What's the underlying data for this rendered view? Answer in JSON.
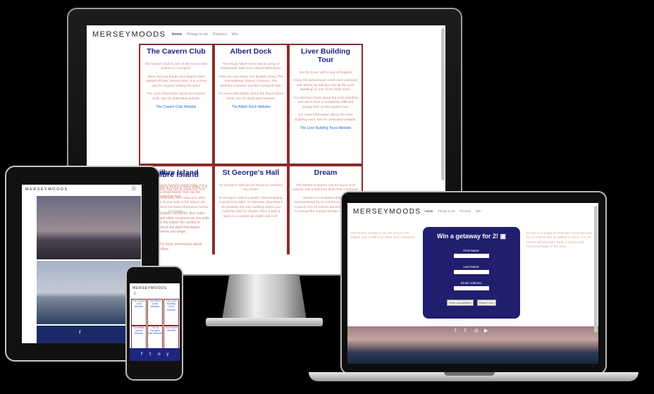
{
  "site": {
    "brand": "MERSEYMOODS",
    "nav": [
      "Home",
      "Things to do",
      "Pictures",
      "Win"
    ]
  },
  "cards": [
    {
      "title": "The Cavern Club",
      "paragraphs": [
        "The Cavern Club is one of the most iconic scenes in Liverpool.",
        "Many famous bands and singers have started off their careers here. It is a must see for anyone visiting the area!",
        "For more information about the Cavern Club, see it's dedicated website."
      ],
      "link": "The Cavern Club Website"
    },
    {
      "title": "Albert Dock",
      "paragraphs": [
        "The Royal Albert Dock has an array of restaurants, bars and cultural attractions.",
        "Here you can enjoy The Beatles Story, The International Slavery museum, The Maritime museum and the Liverpool Tate.",
        "For more information about the Royal Albert Dock, see it's dedicated website."
      ],
      "link": "The Albert Dock Website"
    },
    {
      "title": "Liver Building Tour",
      "paragraphs": [
        "Not for those with a fear of heights!",
        "Enjoy the picturesque views over Liverpool and Wirral, by taking a trip up the Liver Building on one of the daily tours.",
        "You will learn facts about the Liver Building and see it from a completely different perspective on this guided tour.",
        "For more information about the Liver Building tours, see it's dedicated website."
      ],
      "link": "The Liver Building Tours Website"
    },
    {
      "title": "Hilbre Island",
      "paragraphs": [
        "Hilbre Island is found in West Kirby, it is a small island, that can be visited by foot.",
        "Explore rockpools, find crabs and other creatures as you walk to the island. Be careful to check the tidal information before you begin."
      ],
      "link": ""
    },
    {
      "title": "St George's Hall",
      "paragraphs": [
        "St George's Hall can be found in Liverpool city centre.",
        "St George's Hall is a grade I listed building. A quote from BBC Architecture described it as 'possibly the only building where you could be tried for murder, have a ball or listen to a concert all under one roof'."
      ],
      "link": ""
    },
    {
      "title": "Dream",
      "paragraphs": [
        "The Dream sculpture can be found in St Helens, just a half hour drive from Liverpool.",
        "Dream is a sculpture that was commissioned by ex-miners and St Helens Council. It is 20 metres tall and was made to honour the mining heritage of the area."
      ],
      "link": ""
    }
  ],
  "tablet": {
    "brand": "MERSEYMOODS",
    "menu_icon": "hamburger-icon",
    "cut_title": "ilbre Island",
    "text1": "and is found in West Kirby, it is a small island, that can be visited by foot.",
    "text2": "Explore rockpools, find crabs and other creatures as you walk to the island. Be careful to check the tidal information before you begin.",
    "text3": "For more information about Hilbre"
  },
  "phone": {
    "brand": "MERSEYMOODS",
    "cards": [
      "The Cavern Club Website",
      "The Albert Dock Website",
      "The Liver Building Tours Website",
      "The Hilbre Island Website",
      "The St George's Hall Website",
      "The Dream Website"
    ],
    "social": [
      "f",
      "t",
      "o",
      "y"
    ]
  },
  "laptop": {
    "competition": {
      "title": "Win a getaway for 2!",
      "fields": [
        "First Name:",
        "Last Name:",
        "Email Address:"
      ],
      "buttons": [
        "Enter competition",
        "Reset Form"
      ]
    },
    "bg_left": "The Dream sculpture can be found in St Helens, just a half hour drive from Liverpool.",
    "bg_right": "Dream is a sculpture that was commissioned by ex-miners and St Helens Council. It is 20 metres tall and was made to honour the mining heritage of the area.",
    "social_icons": [
      "facebook-icon",
      "twitter-icon",
      "instagram-icon",
      "youtube-icon"
    ]
  },
  "colors": {
    "card_border": "#8a2c2c",
    "card_title": "#1f2680",
    "link": "#2b60d6",
    "competition_bg": "#1f1f6e"
  }
}
